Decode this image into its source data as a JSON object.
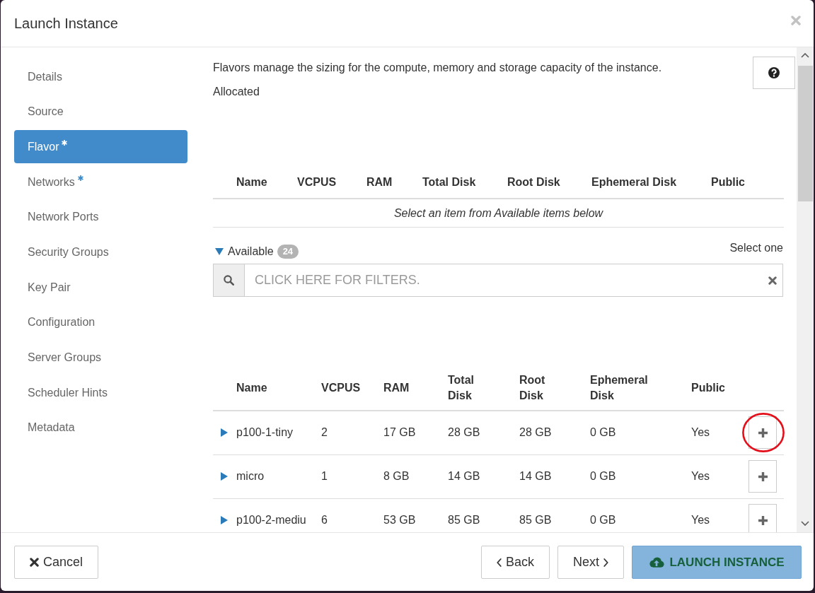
{
  "dialog": {
    "title": "Launch Instance"
  },
  "nav": {
    "items": [
      {
        "label": "Details",
        "selected": false,
        "required": false
      },
      {
        "label": "Source",
        "selected": false,
        "required": false
      },
      {
        "label": "Flavor",
        "selected": true,
        "required": true
      },
      {
        "label": "Networks",
        "selected": false,
        "required": true
      },
      {
        "label": "Network Ports",
        "selected": false,
        "required": false
      },
      {
        "label": "Security Groups",
        "selected": false,
        "required": false
      },
      {
        "label": "Key Pair",
        "selected": false,
        "required": false
      },
      {
        "label": "Configuration",
        "selected": false,
        "required": false
      },
      {
        "label": "Server Groups",
        "selected": false,
        "required": false
      },
      {
        "label": "Scheduler Hints",
        "selected": false,
        "required": false
      },
      {
        "label": "Metadata",
        "selected": false,
        "required": false
      }
    ]
  },
  "flavor_step": {
    "description": "Flavors manage the sizing for the compute, memory and storage capacity of the instance.",
    "allocated_title": "Allocated",
    "allocated_table": {
      "columns": [
        "Name",
        "VCPUS",
        "RAM",
        "Total Disk",
        "Root Disk",
        "Ephemeral Disk",
        "Public"
      ],
      "empty_message": "Select an item from Available items below"
    },
    "available": {
      "label": "Available",
      "count": "24",
      "expanded": true,
      "hint": "Select one"
    },
    "filter": {
      "placeholder": "CLICK HERE FOR FILTERS."
    },
    "available_table": {
      "columns": [
        "Name",
        "VCPUS",
        "RAM",
        "Total Disk",
        "Root Disk",
        "Ephemeral Disk",
        "Public"
      ],
      "rows": [
        {
          "expanded": false,
          "highlighted": true,
          "cells": [
            "p100-1-tiny",
            "2",
            "17 GB",
            "28 GB",
            "28 GB",
            "0 GB",
            "Yes"
          ]
        },
        {
          "expanded": false,
          "highlighted": false,
          "cells": [
            "micro",
            "1",
            "8 GB",
            "14 GB",
            "14 GB",
            "0 GB",
            "Yes"
          ]
        },
        {
          "expanded": false,
          "highlighted": false,
          "cells": [
            "p100-2-mediu",
            "6",
            "53 GB",
            "85 GB",
            "85 GB",
            "0 GB",
            "Yes"
          ]
        }
      ]
    }
  },
  "footer": {
    "left_buttons": [
      {
        "kind": "cancel",
        "label": "Cancel",
        "disabled": false
      }
    ],
    "right_buttons": [
      {
        "kind": "back",
        "label": "Back",
        "disabled": false
      },
      {
        "kind": "next",
        "label": "Next",
        "disabled": false
      },
      {
        "kind": "launch",
        "label": "LAUNCH INSTANCE",
        "disabled": true
      }
    ]
  }
}
